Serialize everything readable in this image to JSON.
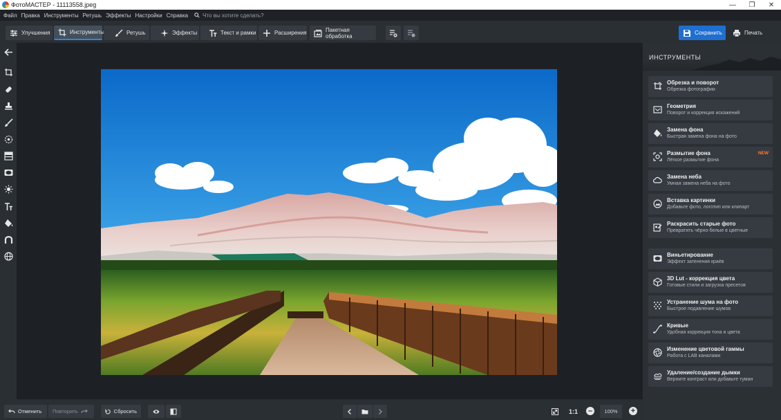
{
  "window": {
    "title": "ФотоМАСТЕР - 11113558.jpeg"
  },
  "menu": {
    "items": [
      "Файл",
      "Правка",
      "Инструменты",
      "Ретушь",
      "Эффекты",
      "Настройки",
      "Справка"
    ],
    "search_placeholder": "Что вы хотите сделать?"
  },
  "toolbar": {
    "tabs": [
      {
        "label": "Улучшения",
        "icon": "sliders-icon"
      },
      {
        "label": "Инструменты",
        "icon": "crop-icon",
        "active": true
      },
      {
        "label": "Ретушь",
        "icon": "brush-icon"
      },
      {
        "label": "Эффекты",
        "icon": "sparkle-icon"
      },
      {
        "label": "Текст и рамки",
        "icon": "text-icon"
      },
      {
        "label": "Расширения",
        "icon": "plus-icon"
      },
      {
        "label": "Пакетная обработка",
        "icon": "batch-icon"
      }
    ],
    "save_label": "Сохранить",
    "print_label": "Печать",
    "accent_color": "#1f6fd1"
  },
  "left_tools": [
    "back-arrow-icon",
    "crop-rotate-icon",
    "patch-icon",
    "stamp-icon",
    "brush-icon",
    "radial-icon",
    "gradient-icon",
    "vignette-icon",
    "light-icon",
    "text-icon",
    "fill-icon",
    "curve-icon",
    "globe-icon"
  ],
  "panel": {
    "title": "ИНСТРУМЕНТЫ",
    "tools": [
      {
        "title": "Обрезка и поворот",
        "subtitle": "Обрезка фотографии",
        "icon": "crop-rotate-icon"
      },
      {
        "title": "Геометрия",
        "subtitle": "Поворот и коррекция искажений",
        "icon": "geometry-icon"
      },
      {
        "title": "Замена фона",
        "subtitle": "Быстрая замена фона на фото",
        "icon": "fill-bucket-icon"
      },
      {
        "title": "Размытие фона",
        "subtitle": "Лёгкое размытие фона",
        "icon": "blur-focus-icon",
        "badge": "NEW"
      },
      {
        "title": "Замена неба",
        "subtitle": "Умная замена неба на фото",
        "icon": "cloud-icon"
      },
      {
        "title": "Вставка картинки",
        "subtitle": "Добавьте фото, логотип или клипарт",
        "icon": "image-insert-icon"
      },
      {
        "title": "Раскрасить старые фото",
        "subtitle": "Превратить чёрно-белые в цветные",
        "icon": "colorize-icon"
      },
      {
        "title": "Виньетирование",
        "subtitle": "Эффект затенения краёв",
        "icon": "vignette-icon"
      },
      {
        "title": "3D Lut - коррекция цвета",
        "subtitle": "Готовые стили и загрузка пресетов",
        "icon": "cube-icon"
      },
      {
        "title": "Устранение шума на фото",
        "subtitle": "Быстрое подавление шумов",
        "icon": "noise-icon"
      },
      {
        "title": "Кривые",
        "subtitle": "Удобная коррекция тона и цвета",
        "icon": "curve-icon"
      },
      {
        "title": "Изменение цветовой гаммы",
        "subtitle": "Работа с LAB каналами",
        "icon": "aperture-icon"
      },
      {
        "title": "Удаление/создание дымки",
        "subtitle": "Верните контраст или добавьте туман",
        "icon": "haze-icon"
      }
    ]
  },
  "bottom": {
    "undo_label": "Отменить",
    "redo_label": "Повторить",
    "reset_label": "Сбросить",
    "one_to_one": "1:1",
    "zoom": "100%"
  }
}
